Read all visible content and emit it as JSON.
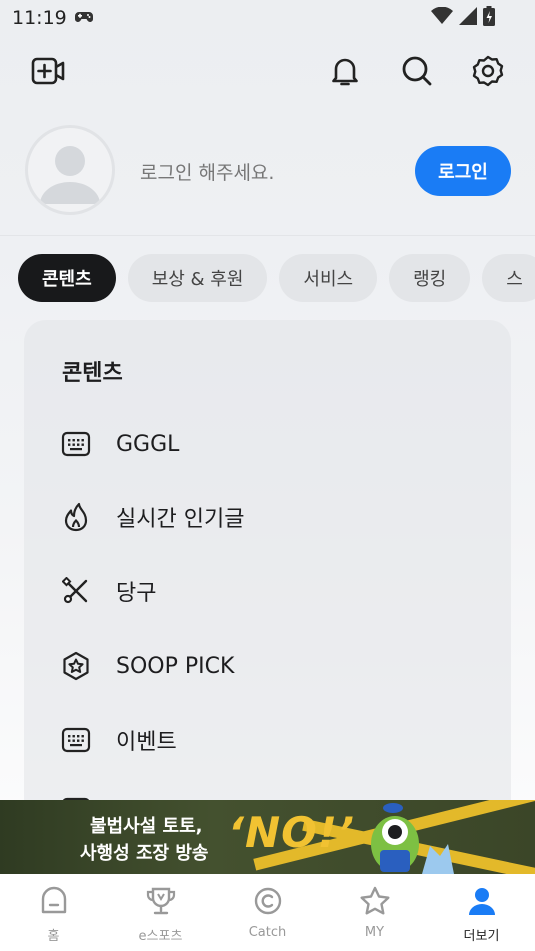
{
  "status_bar": {
    "time": "11:19"
  },
  "profile": {
    "prompt": "로그인 해주세요.",
    "login_label": "로그인"
  },
  "tabs": [
    {
      "label": "콘텐츠",
      "active": true
    },
    {
      "label": "보상 & 후원",
      "active": false
    },
    {
      "label": "서비스",
      "active": false
    },
    {
      "label": "랭킹",
      "active": false
    },
    {
      "label": "스",
      "active": false
    }
  ],
  "section": {
    "title": "콘텐츠",
    "items": [
      {
        "label": "GGGL",
        "icon": "keyboard-icon"
      },
      {
        "label": "실시간 인기글",
        "icon": "flame-icon"
      },
      {
        "label": "당구",
        "icon": "billiards-cue-icon"
      },
      {
        "label": "SOOP PICK",
        "icon": "star-badge-icon"
      },
      {
        "label": "이벤트",
        "icon": "keyboard-icon"
      }
    ]
  },
  "banner": {
    "line1": "불법사설 토토,",
    "line2": "사행성 조장 방송",
    "headline": "‘NO!’"
  },
  "bottom_nav": [
    {
      "label": "홈",
      "icon": "home-icon",
      "active": false
    },
    {
      "label": "e스포츠",
      "icon": "trophy-icon",
      "active": false
    },
    {
      "label": "Catch",
      "icon": "catch-icon",
      "active": false
    },
    {
      "label": "MY",
      "icon": "star-icon",
      "active": false
    },
    {
      "label": "더보기",
      "icon": "profile-icon",
      "active": true
    }
  ],
  "colors": {
    "accent": "#1a7cf5",
    "active_tab": "#18191b",
    "active_nav_icon": "#1a7cf5"
  }
}
